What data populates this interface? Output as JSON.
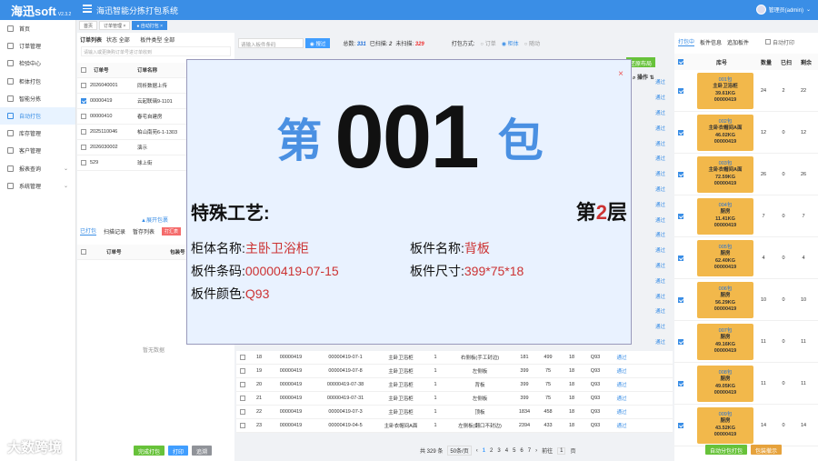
{
  "topbar": {
    "logo": "海迅soft",
    "version": "V2.3.2",
    "title": "海迅智能分拣打包系统",
    "user": "管理员(admin)"
  },
  "sidebar": {
    "items": [
      {
        "label": "首页",
        "icon": "home-icon"
      },
      {
        "label": "订单管理",
        "icon": "order-icon"
      },
      {
        "label": "检验中心",
        "icon": "check-icon"
      },
      {
        "label": "柜体打包",
        "icon": "cabinet-icon"
      },
      {
        "label": "智能分拣",
        "icon": "sort-icon"
      },
      {
        "label": "自动打包",
        "icon": "auto-pack-icon",
        "active": true
      },
      {
        "label": "库存管理",
        "icon": "stock-icon"
      },
      {
        "label": "客户管理",
        "icon": "customer-icon"
      },
      {
        "label": "报表查询",
        "icon": "report-icon",
        "arrow": "⌄"
      },
      {
        "label": "系统管理",
        "icon": "settings-icon",
        "arrow": "⌄"
      }
    ]
  },
  "tabs": [
    "首页",
    "订单管理 ×",
    "● 自动打包 ×"
  ],
  "left": {
    "filter_label": "订单列表",
    "status_label": "状态",
    "status_value": "全部",
    "type_label": "板件类型",
    "type_value": "全部",
    "search_placeholder": "请输入或更换购订单号进订单收到",
    "headers": [
      "订单号",
      "订单名称"
    ],
    "rows": [
      {
        "no": "2026040001",
        "name": "同析数据上传",
        "checked": false
      },
      {
        "no": "00000419",
        "name": "云起联璃9-1101",
        "checked": true
      },
      {
        "no": "00000410",
        "name": "春宅自建房",
        "checked": false
      },
      {
        "no": "2025110046",
        "name": "柏山南苑6-1-1303",
        "checked": false
      },
      {
        "no": "2026030002",
        "name": "演示",
        "checked": false
      },
      {
        "no": "529",
        "name": "球上街",
        "checked": false
      }
    ],
    "expand": "▲展开包裹",
    "subtabs": [
      "已打包",
      "扫描记录",
      "暂存列表"
    ],
    "subtab_red": "打汇表",
    "sub_headers": [
      "订单号",
      "包装号"
    ],
    "nodata": "暂无数据",
    "buttons": {
      "finish": "完成打包",
      "print": "打印",
      "cancel": "追溯"
    }
  },
  "middle": {
    "search_placeholder": "请输入板件条码",
    "search_btn": "搜过",
    "total_label": "总数:",
    "total": "331",
    "packed_label": "已扫描:",
    "packed": "2",
    "unpacked_label": "未扫描:",
    "unpacked": "329",
    "mode_label": "打包方式:",
    "modes": [
      "订单",
      "柜体",
      "随动"
    ],
    "mode_selected": 1,
    "layout_btn": "还原布局",
    "op_header": "操作",
    "op_link": "通过",
    "rows": [
      {
        "n": "18",
        "o": "00000419",
        "code": "00000419-07-1",
        "cab": "主卧卫浴柜",
        "q": "1",
        "part": "右侧板(手工封边)",
        "l": "181",
        "w": "499",
        "t": "18",
        "c": "Q93"
      },
      {
        "n": "19",
        "o": "00000419",
        "code": "00000419-07-8",
        "cab": "主卧卫浴柜",
        "q": "1",
        "part": "左侧板",
        "l": "399",
        "w": "75",
        "t": "18",
        "c": "Q93"
      },
      {
        "n": "20",
        "o": "00000419",
        "code": "00000419-07-38",
        "cab": "主卧卫浴柜",
        "q": "1",
        "part": "背板",
        "l": "399",
        "w": "75",
        "t": "18",
        "c": "Q93"
      },
      {
        "n": "21",
        "o": "00000419",
        "code": "00000419-07-31",
        "cab": "主卧卫浴柜",
        "q": "1",
        "part": "左侧板",
        "l": "399",
        "w": "75",
        "t": "18",
        "c": "Q93"
      },
      {
        "n": "22",
        "o": "00000419",
        "code": "00000419-07-3",
        "cab": "主卧卫浴柜",
        "q": "1",
        "part": "顶板",
        "l": "1834",
        "w": "458",
        "t": "18",
        "c": "Q93"
      },
      {
        "n": "23",
        "o": "00000419",
        "code": "00000419-04-5",
        "cab": "主卧衣帽间A面",
        "q": "1",
        "part": "左侧板(翻口不封边)",
        "l": "2394",
        "w": "433",
        "t": "18",
        "c": "Q93"
      }
    ],
    "pager": {
      "total": "共 329 条",
      "size": "50条/页",
      "pages": [
        "1",
        "2",
        "3",
        "4",
        "5",
        "6",
        "7"
      ],
      "goto_label": "前往",
      "goto": "1",
      "page_suffix": "页"
    }
  },
  "right": {
    "tabs": [
      "打包中",
      "板件信息",
      "追加板件"
    ],
    "auto_label": "自动打印",
    "headers": [
      "库号",
      "数量",
      "已扫",
      "剩余"
    ],
    "rows": [
      {
        "no": "001包",
        "room": "主卧卫浴柜",
        "weight": "39.61KG",
        "order": "00000419",
        "qty": "24",
        "scan": "2",
        "left": "22"
      },
      {
        "no": "002包",
        "room": "主卧衣帽间A面",
        "weight": "46.02KG",
        "order": "00000419",
        "qty": "12",
        "scan": "0",
        "left": "12"
      },
      {
        "no": "003包",
        "room": "主卧衣帽间A面",
        "weight": "72.59KG",
        "order": "00000419",
        "qty": "26",
        "scan": "0",
        "left": "26"
      },
      {
        "no": "004包",
        "room": "厨房",
        "weight": "11.41KG",
        "order": "00000419",
        "qty": "7",
        "scan": "0",
        "left": "7"
      },
      {
        "no": "005包",
        "room": "厨房",
        "weight": "62.40KG",
        "order": "00000419",
        "qty": "4",
        "scan": "0",
        "left": "4"
      },
      {
        "no": "006包",
        "room": "厨房",
        "weight": "56.29KG",
        "order": "00000419",
        "qty": "10",
        "scan": "0",
        "left": "10"
      },
      {
        "no": "007包",
        "room": "厨房",
        "weight": "49.16KG",
        "order": "00000419",
        "qty": "11",
        "scan": "0",
        "left": "11"
      },
      {
        "no": "008包",
        "room": "厨房",
        "weight": "49.05KG",
        "order": "00000419",
        "qty": "11",
        "scan": "0",
        "left": "11"
      },
      {
        "no": "009包",
        "room": "厨房",
        "weight": "43.52KG",
        "order": "00000419",
        "qty": "14",
        "scan": "0",
        "left": "14"
      }
    ],
    "btn_auto": "自动分包打包",
    "btn_drop": "包装撤示"
  },
  "modal": {
    "prefix": "第",
    "number": "001",
    "suffix": "包",
    "craft": "特殊工艺:",
    "layer_prefix": "第",
    "layer": "2",
    "layer_suffix": "层",
    "cabinet_label": "柜体名称:",
    "cabinet": "主卧卫浴柜",
    "part_label": "板件名称:",
    "part": "背板",
    "code_label": "板件条码:",
    "code": "00000419-07-15",
    "size_label": "板件尺寸:",
    "size": "399*75*18",
    "color_label": "板件颜色:",
    "color": "Q93",
    "close": "×"
  },
  "watermark": "大数跨境",
  "colors": {
    "primary": "#3a8ee6",
    "card": "#f2b84b",
    "danger": "#e33",
    "success": "#67c23a"
  }
}
